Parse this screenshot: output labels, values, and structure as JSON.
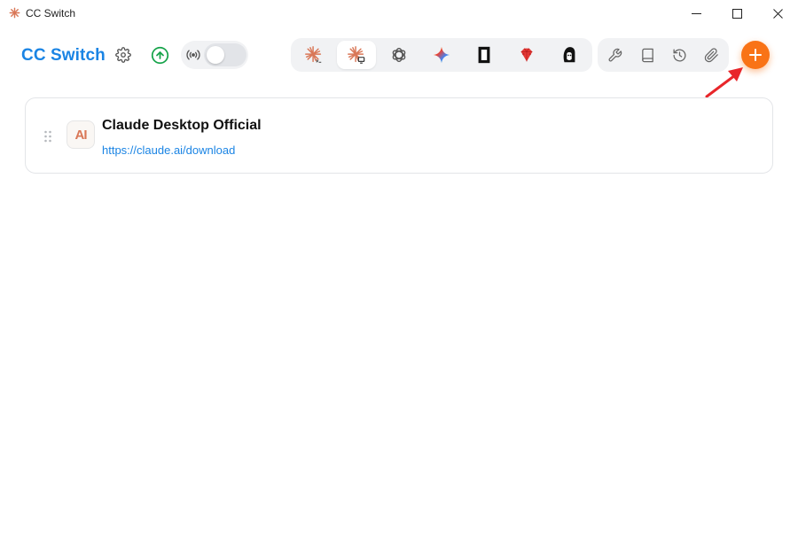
{
  "window": {
    "title": "CC Switch"
  },
  "header": {
    "brand": "CC Switch"
  },
  "toolbar": {
    "proxy_enabled": false,
    "apps": [
      {
        "id": "claude-code",
        "icon": "claude-cli-icon",
        "active": false
      },
      {
        "id": "claude-desktop",
        "icon": "claude-desktop-icon",
        "active": true
      },
      {
        "id": "codex",
        "icon": "openai-icon",
        "active": false
      },
      {
        "id": "gemini",
        "icon": "gemini-icon",
        "active": false
      },
      {
        "id": "opencode",
        "icon": "opencode-icon",
        "active": false
      },
      {
        "id": "ruby",
        "icon": "ruby-icon",
        "active": false
      },
      {
        "id": "mascot",
        "icon": "mascot-icon",
        "active": false
      }
    ],
    "tools": [
      "wrench-icon",
      "book-icon",
      "history-icon",
      "paperclip-icon"
    ]
  },
  "providers": [
    {
      "name": "Claude Desktop Official",
      "url": "https://claude.ai/download",
      "logo": "AI"
    }
  ],
  "colors": {
    "accent": "#1a84e4",
    "add_button": "#f97316",
    "arrow": "#e8262a",
    "claude": "#d97757"
  }
}
